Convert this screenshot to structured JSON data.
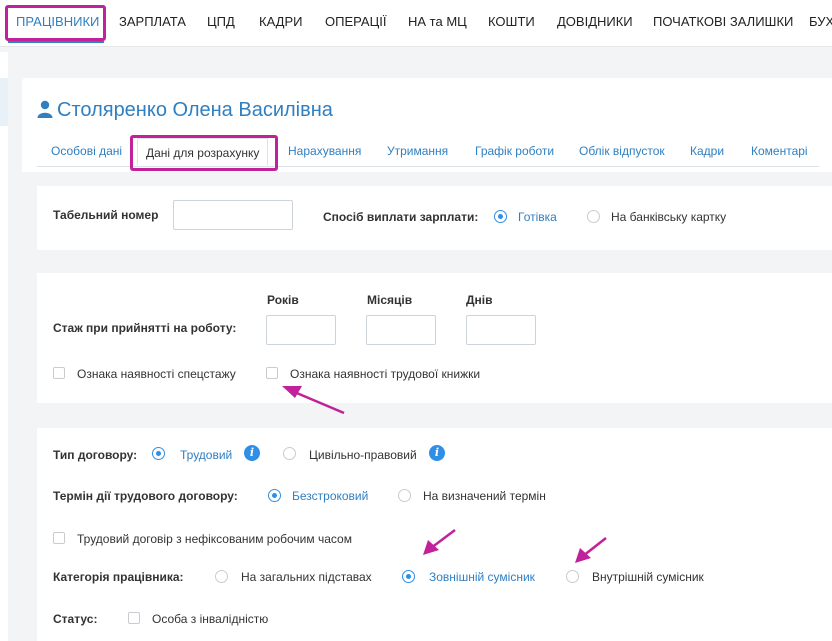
{
  "top_nav": {
    "items": [
      "ПРАЦІВНИКИ",
      "ЗАРПЛАТА",
      "ЦПД",
      "КАДРИ",
      "ОПЕРАЦІЇ",
      "НА та МЦ",
      "КОШТИ",
      "ДОВІДНИКИ",
      "ПОЧАТКОВІ ЗАЛИШКИ",
      "БУХ"
    ],
    "active": "ПРАЦІВНИКИ"
  },
  "employee": {
    "name": "Столяренко Олена Василівна",
    "icon": "user-icon"
  },
  "tabs": {
    "items": [
      "Особові дані",
      "Дані для розрахунку",
      "Нарахування",
      "Утримання",
      "Графік роботи",
      "Облік відпусток",
      "Кадри",
      "Коментарі"
    ],
    "active": "Дані для розрахунку"
  },
  "payment": {
    "tab_number_label": "Табельний номер",
    "tab_number_value": "",
    "method_label": "Спосіб виплати зарплати:",
    "options": [
      "Готівка",
      "На банківську картку"
    ],
    "selected": "Готівка"
  },
  "seniority": {
    "label": "Стаж при прийнятті на роботу:",
    "years_label": "Років",
    "months_label": "Місяців",
    "days_label": "Днів",
    "years_value": "",
    "months_value": "",
    "days_value": "",
    "special_seniority_label": "Ознака наявності спецстажу",
    "special_seniority_checked": false,
    "work_book_label": "Ознака наявності трудової книжки",
    "work_book_checked": false
  },
  "contract": {
    "type_label": "Тип договору:",
    "type_options": [
      "Трудовий",
      "Цивільно-правовий"
    ],
    "type_selected": "Трудовий",
    "term_label": "Термін дії трудового договору:",
    "term_options": [
      "Безстроковий",
      "На визначений термін"
    ],
    "term_selected": "Безстроковий",
    "unfixed_hours_label": "Трудовий договір з нефіксованим робочим часом",
    "unfixed_hours_checked": false,
    "category_label": "Категорія працівника:",
    "category_options": [
      "На загальних підставах",
      "Зовнішній сумісник",
      "Внутрішній сумісник"
    ],
    "category_selected": "Зовнішній сумісник",
    "status_label": "Статус:",
    "disability_label": "Особа з інвалідністю",
    "disability_checked": false
  },
  "colors": {
    "accent": "#2f7fc1",
    "annotation": "#c1219a",
    "radio": "#2f8fe6"
  }
}
